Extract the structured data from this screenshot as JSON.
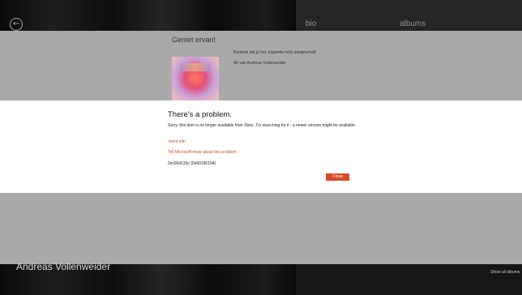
{
  "hub": {
    "nav": {
      "bio": "bio",
      "albums": "albums"
    },
    "artist_name": "Andreas Vollenweider",
    "show_all": "Show all albums"
  },
  "purchase": {
    "title": "Geniet ervan!",
    "thanks": "Bedankt dat je het volgende hebt aangeschaft",
    "item": "Air van Andreas Vollenweider"
  },
  "dialog": {
    "title": "There's a problem.",
    "message": "Sorry, this item is no longer available from Xbox. Try searching for it - a newer version might be available.",
    "more_info": "more info",
    "tell_microsoft": "Tell Microsoft more about this problem",
    "error_code": "0xc00d133c (0x80190194)",
    "close_label": "Close"
  },
  "colors": {
    "accent": "#d84a2a",
    "link": "#d04a1e"
  }
}
